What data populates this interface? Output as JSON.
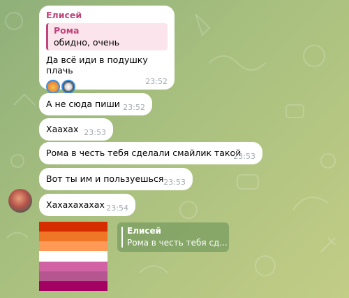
{
  "chat": {
    "messages": [
      {
        "sender": "Елисей",
        "quote": {
          "name": "Рома",
          "text": "обидно, очень"
        },
        "text": "Да всё иди в подушку плачь",
        "time": "23:52",
        "reactions": [
          "smiling-face-sticker",
          "dark-figure-sticker"
        ]
      },
      {
        "text": "А не сюда пиши",
        "time": "23:52"
      },
      {
        "text": "Хаахах",
        "time": "23:53"
      },
      {
        "text": "Рома в честь тебя сделали смайлик такой",
        "time": "23:53"
      },
      {
        "text": "Вот ты им и пользуешься",
        "time": "23:53"
      },
      {
        "text": "Хахахахахах",
        "time": "23:54"
      }
    ],
    "sticker": {
      "type": "flag",
      "stripes": [
        "#d52d00",
        "#ef7627",
        "#ff9a56",
        "#ffffff",
        "#d162a4",
        "#b55690",
        "#a30262"
      ]
    },
    "reply_preview": {
      "name": "Елисей",
      "text": "Рома в честь тебя сд..."
    }
  },
  "colors": {
    "sender_name": "#c0447b",
    "timestamp": "#a4abb1",
    "accent": "#3d8fe0"
  }
}
